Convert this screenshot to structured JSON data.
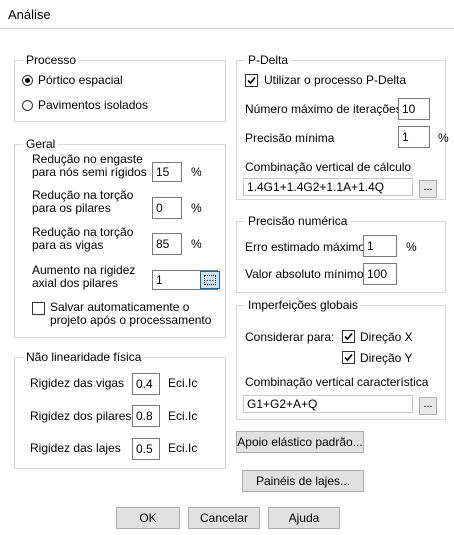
{
  "window": {
    "title": "Análise"
  },
  "processo": {
    "legend": "Processo",
    "options": [
      {
        "label": "Pórtico espacial",
        "selected": true
      },
      {
        "label": "Pavimentos isolados",
        "selected": false
      }
    ]
  },
  "geral": {
    "legend": "Geral",
    "fields": [
      {
        "label_line1": "Redução no engaste",
        "label_line2": "para nós semi rígidos",
        "value": "15",
        "unit": "%"
      },
      {
        "label_line1": "Redução na torção",
        "label_line2": "para os pilares",
        "value": "0",
        "unit": "%"
      },
      {
        "label_line1": "Redução na torção",
        "label_line2": "para as vigas",
        "value": "85",
        "unit": "%"
      },
      {
        "label_line1": "Aumento na rigidez",
        "label_line2": "axial dos pilares",
        "value": "1"
      }
    ],
    "salvar_line1": "Salvar automaticamente o",
    "salvar_line2": "projeto após o processamento",
    "salvar_checked": false
  },
  "nao_linearidade": {
    "legend": "Não linearidade física",
    "rows": [
      {
        "label": "Rigidez das vigas",
        "value": "0.4",
        "unit": "Eci.Ic"
      },
      {
        "label": "Rigidez dos pilares",
        "value": "0.8",
        "unit": "Eci.Ic"
      },
      {
        "label": "Rigidez das lajes",
        "value": "0.5",
        "unit": "Eci.Ic"
      }
    ]
  },
  "pdelta": {
    "legend": "P-Delta",
    "usar_label": "Utilizar o processo P-Delta",
    "usar_checked": true,
    "iter_label": "Número máximo de iterações",
    "iter_value": "10",
    "prec_label": "Precisão mínima",
    "prec_value": "1",
    "prec_unit": "%",
    "comb_label": "Combinação vertical de cálculo",
    "comb_value": "1.4G1+1.4G2+1.1A+1.4Q",
    "ellipsis": "..."
  },
  "precisao": {
    "legend": "Precisão numérica",
    "erro_label": "Erro estimado máximo",
    "erro_value": "1",
    "erro_unit": "%",
    "valor_label": "Valor absoluto mínimo",
    "valor_value": "100"
  },
  "imperfeicoes": {
    "legend": "Imperfeições globais",
    "considerar_label": "Considerar para:",
    "dir_x_label": "Direção X",
    "dir_x_checked": true,
    "dir_y_label": "Direção Y",
    "dir_y_checked": true,
    "comb_label": "Combinação vertical característica",
    "comb_value": "G1+G2+A+Q",
    "ellipsis": "..."
  },
  "buttons": {
    "apoio": "Apoio elástico padrão...",
    "paineis": "Painéis de lajes...",
    "ok": "OK",
    "cancelar": "Cancelar",
    "ajuda": "Ajuda"
  }
}
